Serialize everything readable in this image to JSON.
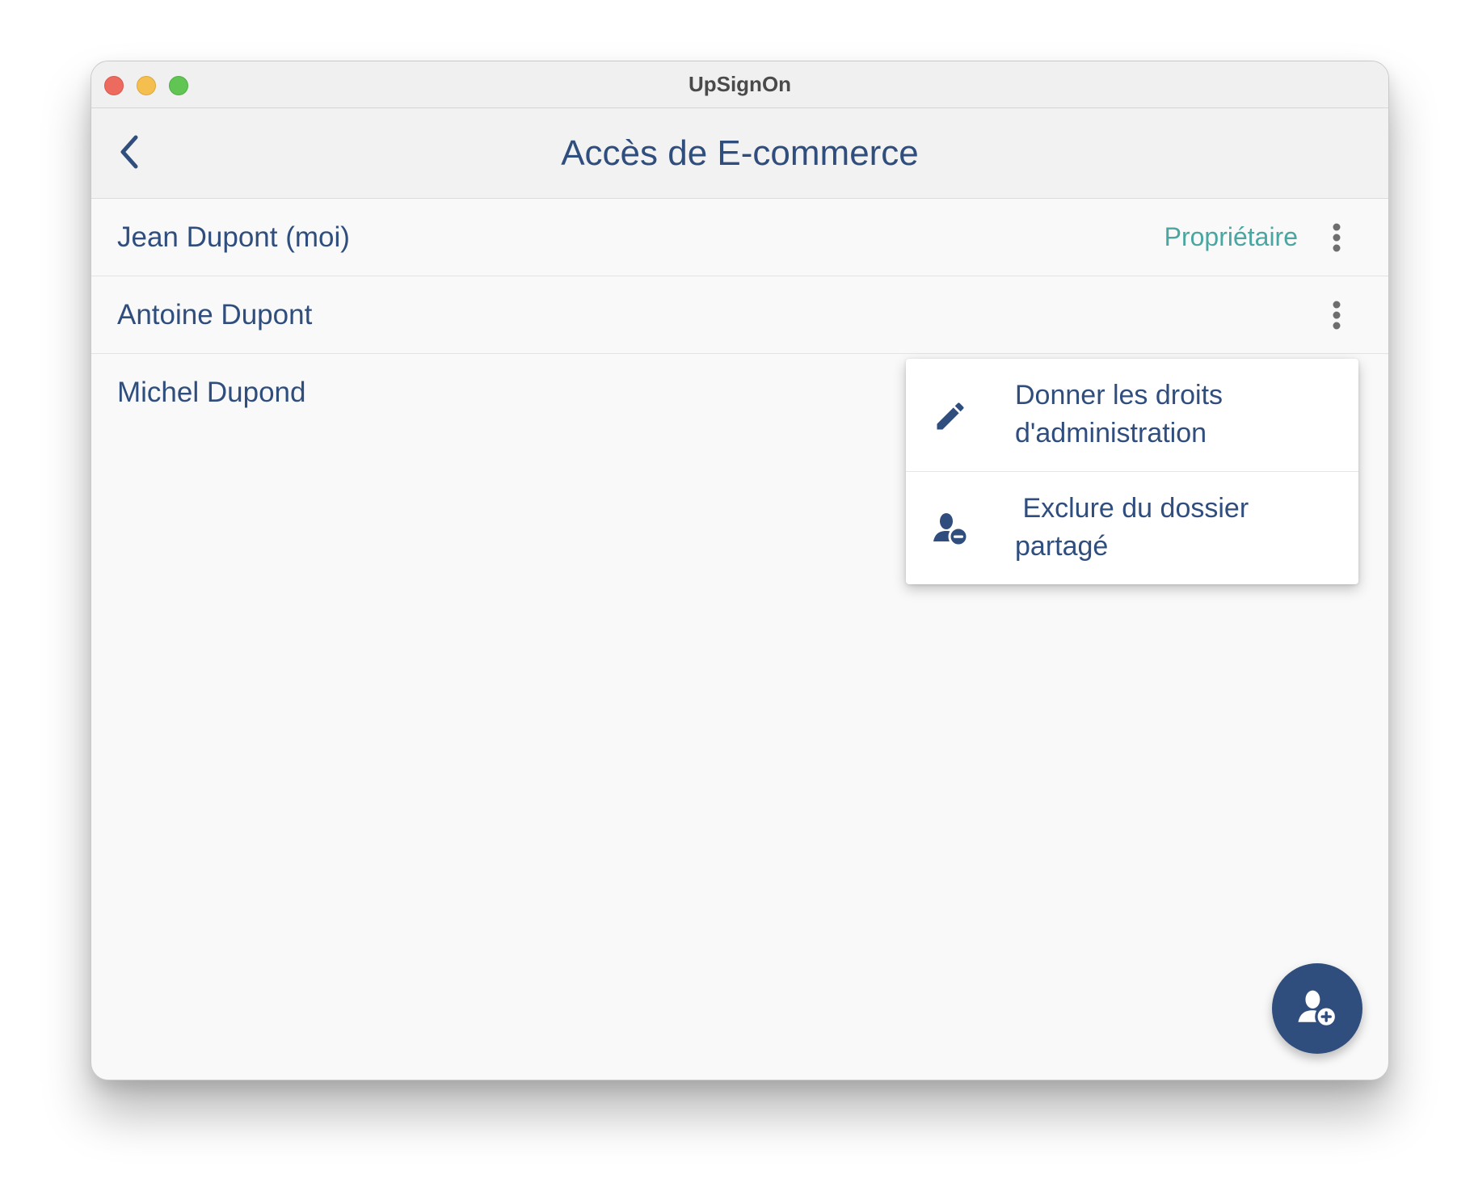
{
  "window": {
    "title": "UpSignOn"
  },
  "header": {
    "title": "Accès de E-commerce",
    "back_icon": "chevron-left-icon"
  },
  "members": [
    {
      "name": "Jean Dupont (moi)",
      "role": "Propriétaire"
    },
    {
      "name": "Antoine Dupont",
      "role": ""
    },
    {
      "name": "Michel Dupond",
      "role": ""
    }
  ],
  "context_menu": {
    "items": [
      {
        "label": "Donner les droits\nd'administration",
        "icon": "pencil-icon"
      },
      {
        "label": " Exclure du dossier\npartagé",
        "icon": "remove-user-icon"
      }
    ]
  },
  "fab": {
    "icon": "add-user-icon"
  },
  "colors": {
    "primary": "#2f4e7e",
    "role_text": "#4aa6a0",
    "kebab": "#6e6e6e"
  }
}
